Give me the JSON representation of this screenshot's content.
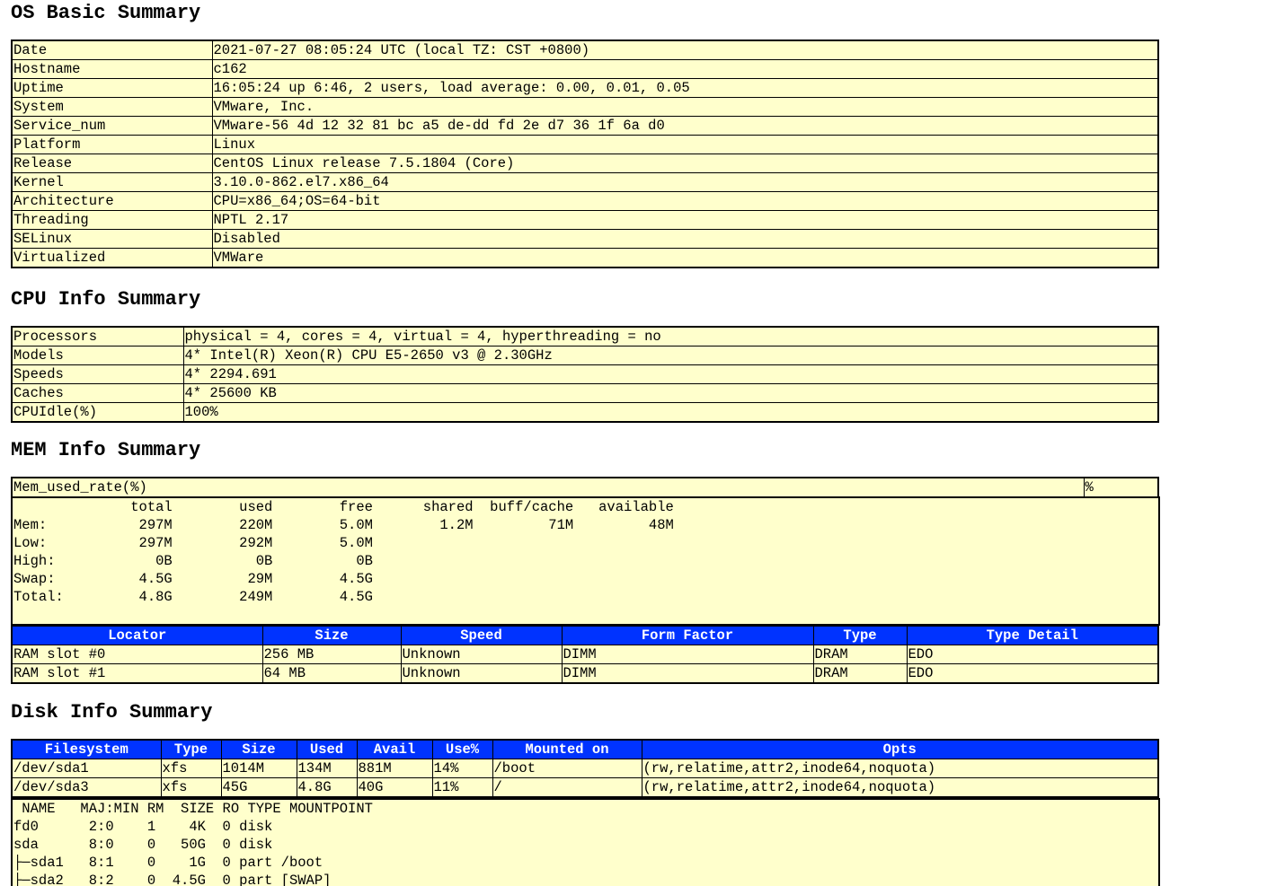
{
  "os": {
    "title": "OS Basic Summary",
    "rows": [
      {
        "key": "Date",
        "value": "2021-07-27 08:05:24 UTC (local TZ: CST +0800)"
      },
      {
        "key": "Hostname",
        "value": "c162"
      },
      {
        "key": "Uptime",
        "value": "16:05:24 up 6:46, 2 users, load average: 0.00, 0.01, 0.05"
      },
      {
        "key": "System",
        "value": "VMware, Inc."
      },
      {
        "key": "Service_num",
        "value": "VMware-56 4d 12 32 81 bc a5 de-dd fd 2e d7 36 1f 6a d0"
      },
      {
        "key": "Platform",
        "value": "Linux"
      },
      {
        "key": "Release",
        "value": "CentOS Linux release 7.5.1804 (Core)"
      },
      {
        "key": "Kernel",
        "value": "3.10.0-862.el7.x86_64"
      },
      {
        "key": "Architecture",
        "value": "CPU=x86_64;OS=64-bit"
      },
      {
        "key": "Threading",
        "value": "NPTL 2.17"
      },
      {
        "key": "SELinux",
        "value": "Disabled"
      },
      {
        "key": "Virtualized",
        "value": "VMWare"
      }
    ]
  },
  "cpu": {
    "title": "CPU Info Summary",
    "rows": [
      {
        "key": "Processors",
        "value": "physical = 4, cores = 4, virtual = 4, hyperthreading = no"
      },
      {
        "key": "Models",
        "value": "4* Intel(R) Xeon(R) CPU E5-2650 v3 @ 2.30GHz"
      },
      {
        "key": "Speeds",
        "value": "4* 2294.691"
      },
      {
        "key": "Caches",
        "value": "4* 25600 KB"
      },
      {
        "key": "CPUIdle(%)",
        "value": "100%"
      }
    ]
  },
  "mem": {
    "title": "MEM Info Summary",
    "used_rate_label": "Mem_used_rate(%)",
    "used_rate_value": "%",
    "free_output": "              total        used        free      shared  buff/cache   available\nMem:           297M        220M        5.0M        1.2M         71M         48M\nLow:           297M        292M        5.0M\nHigh:            0B          0B          0B\nSwap:          4.5G         29M        4.5G\nTotal:         4.8G        249M        4.5G\n",
    "slot_headers": [
      "Locator",
      "Size",
      "Speed",
      "Form Factor",
      "Type",
      "Type Detail"
    ],
    "slots": [
      [
        "RAM slot #0",
        "256 MB",
        "Unknown",
        "DIMM",
        "DRAM",
        "EDO"
      ],
      [
        "RAM slot #1",
        "64 MB",
        "Unknown",
        "DIMM",
        "DRAM",
        "EDO"
      ]
    ]
  },
  "disk": {
    "title": "Disk Info Summary",
    "headers": [
      "Filesystem",
      "Type",
      "Size",
      "Used",
      "Avail",
      "Use%",
      "Mounted on",
      "Opts"
    ],
    "rows": [
      [
        "/dev/sda1",
        "xfs",
        "1014M",
        "134M",
        "881M",
        "14%",
        "/boot",
        "(rw,relatime,attr2,inode64,noquota)"
      ],
      [
        "/dev/sda3",
        "xfs",
        "45G",
        "4.8G",
        "40G",
        "11%",
        "/",
        "(rw,relatime,attr2,inode64,noquota)"
      ]
    ],
    "lsblk_output": " NAME   MAJ:MIN RM  SIZE RO TYPE MOUNTPOINT\nfd0      2:0    1    4K  0 disk\nsda      8:0    0   50G  0 disk\n├─sda1   8:1    0    1G  0 part /boot\n├─sda2   8:2    0  4.5G  0 part [SWAP]"
  }
}
